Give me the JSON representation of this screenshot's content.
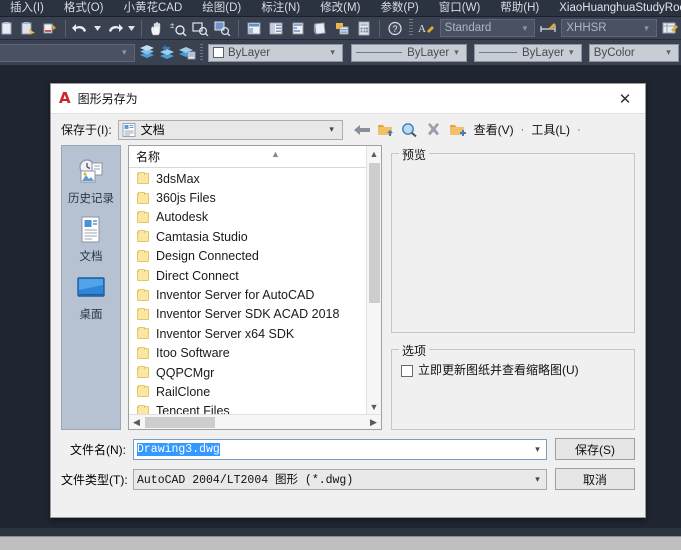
{
  "app": {
    "menus": [
      {
        "label": "插入(I)",
        "accel": "I"
      },
      {
        "label": "格式(O)",
        "accel": "O"
      },
      {
        "label": "小黄花CAD",
        "accel": ""
      },
      {
        "label": "绘图(D)",
        "accel": "D"
      },
      {
        "label": "标注(N)",
        "accel": "N"
      },
      {
        "label": "修改(M)",
        "accel": "M"
      },
      {
        "label": "参数(P)",
        "accel": "P"
      },
      {
        "label": "窗口(W)",
        "accel": "W"
      },
      {
        "label": "帮助(H)",
        "accel": "H"
      },
      {
        "label": "XiaoHuanghuaStudyRoom",
        "accel": ""
      }
    ],
    "toolbar1": {
      "icons": [
        "paste-icon",
        "paste-special-icon",
        "match-properties-icon",
        "undo-icon",
        "undo-dropdown-icon",
        "redo-icon",
        "redo-dropdown-icon",
        "pan-icon",
        "zoom-realtime-icon",
        "zoom-window-icon",
        "zoom-previous-icon",
        "properties-icon",
        "designcenter-icon",
        "toolpalettes-icon",
        "sheetset-icon",
        "markup-icon",
        "calculator-icon",
        "help-icon"
      ],
      "text_style": {
        "label_icon": "text-style-icon",
        "value": "Standard"
      },
      "dim_style": {
        "label_icon": "dim-style-icon",
        "value": "XHHSR"
      },
      "table_style_icon": "table-style-icon"
    },
    "toolbar2": {
      "layer_icons": [
        "layer-properties-icon",
        "layer-previous-icon",
        "layer-states-icon"
      ],
      "layer": {
        "value": "ByLayer",
        "swatch": "#ffffff"
      },
      "linetype": {
        "value": "ByLayer"
      },
      "lineweight": {
        "value": "ByLayer"
      },
      "plotstyle": {
        "value": "ByColor"
      }
    }
  },
  "dialog": {
    "title": "图形另存为",
    "logo_icon": "autocad-logo-icon",
    "close_icon": "close-icon",
    "save_in": {
      "label": "保存于(I):",
      "value": "文档",
      "icon": "documents-icon",
      "dropdown_icon": "chevron-down-icon"
    },
    "toolbar": {
      "back_icon": "back-arrow-icon",
      "up_icon": "up-folder-icon",
      "search_icon": "search-icon",
      "delete_icon": "delete-x-icon",
      "newfolder_icon": "new-folder-icon",
      "view_label": "查看(V)",
      "view_dropdown_icon": "chevron-down-icon",
      "tools_label": "工具(L)",
      "tools_dropdown_icon": "chevron-down-icon"
    },
    "places": [
      {
        "label": "历史记录",
        "icon": "history-icon"
      },
      {
        "label": "文档",
        "icon": "documents-icon"
      },
      {
        "label": "桌面",
        "icon": "desktop-icon"
      }
    ],
    "file_list": {
      "column_header": "名称",
      "sort_icon": "sort-ascending-icon",
      "items": [
        {
          "name": "3dsMax",
          "icon": "folder-icon"
        },
        {
          "name": "360js Files",
          "icon": "folder-icon"
        },
        {
          "name": "Autodesk",
          "icon": "folder-icon"
        },
        {
          "name": "Camtasia Studio",
          "icon": "folder-icon"
        },
        {
          "name": "Design Connected",
          "icon": "folder-icon"
        },
        {
          "name": "Direct Connect",
          "icon": "folder-icon"
        },
        {
          "name": "Inventor Server for AutoCAD",
          "icon": "folder-icon"
        },
        {
          "name": "Inventor Server SDK ACAD 2018",
          "icon": "folder-icon"
        },
        {
          "name": "Inventor Server x64 SDK",
          "icon": "folder-icon"
        },
        {
          "name": "Itoo Software",
          "icon": "folder-icon"
        },
        {
          "name": "QQPCMgr",
          "icon": "folder-icon"
        },
        {
          "name": "RailClone",
          "icon": "folder-icon"
        },
        {
          "name": "Tencent Files",
          "icon": "folder-icon"
        }
      ],
      "scroll_up_icon": "chevron-up-icon",
      "scroll_down_icon": "chevron-down-icon",
      "scroll_left_icon": "chevron-left-icon",
      "scroll_right_icon": "chevron-right-icon"
    },
    "preview": {
      "title": "预览",
      "content": ""
    },
    "options": {
      "title": "选项",
      "checkbox_label": "立即更新图纸并查看缩略图(U)",
      "checkbox_checked": false
    },
    "filename": {
      "label": "文件名(N):",
      "value": "Drawing3.dwg",
      "selected": true,
      "dropdown_icon": "chevron-down-icon"
    },
    "filetype": {
      "label": "文件类型(T):",
      "value": "AutoCAD 2004/LT2004 图形 (*.dwg)",
      "dropdown_icon": "chevron-down-icon"
    },
    "save_button": "保存(S)",
    "cancel_button": "取消"
  },
  "colors": {
    "canvas": "#1f2531",
    "toolbar": "#3a4150",
    "menubar": "#2b3240",
    "dialog_bg": "#f0f0f0",
    "accent": "#cc2229",
    "selection": "#3399ff",
    "places_bg": "#b6c2d1"
  }
}
